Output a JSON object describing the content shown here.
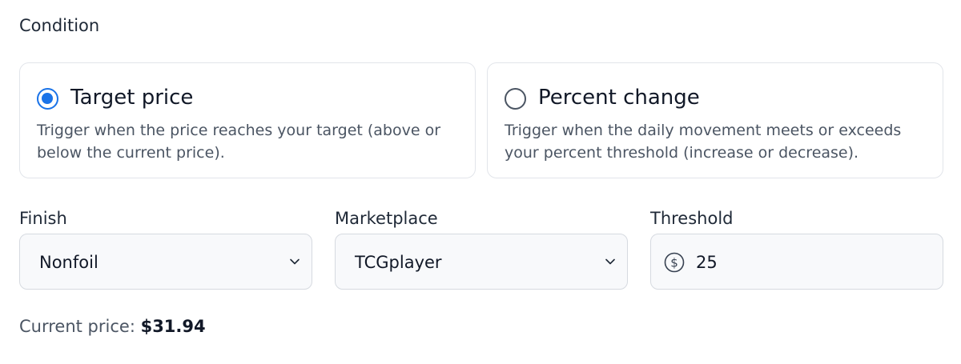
{
  "condition": {
    "label": "Condition",
    "options": [
      {
        "title": "Target price",
        "description": "Trigger when the price reaches your target (above or below the current price).",
        "selected": true
      },
      {
        "title": "Percent change",
        "description": "Trigger when the daily movement meets or exceeds your percent threshold (increase or decrease).",
        "selected": false
      }
    ]
  },
  "fields": {
    "finish": {
      "label": "Finish",
      "value": "Nonfoil"
    },
    "marketplace": {
      "label": "Marketplace",
      "value": "TCGplayer"
    },
    "threshold": {
      "label": "Threshold",
      "value": "25",
      "icon": "dollar-circle-icon"
    }
  },
  "current_price": {
    "label": "Current price:",
    "value": "$31.94"
  },
  "colors": {
    "accent": "#1a73e8",
    "border": "#e2e5ea",
    "field_bg": "#f8f9fb"
  }
}
